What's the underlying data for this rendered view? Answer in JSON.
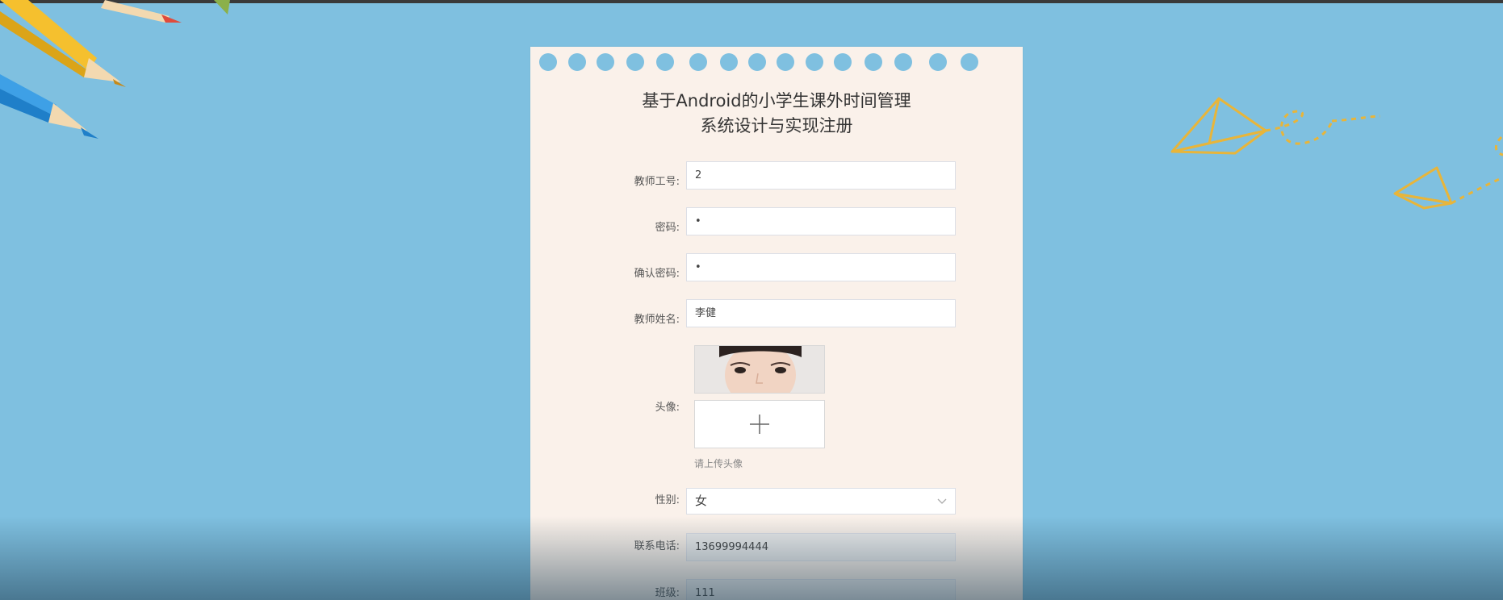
{
  "form": {
    "title_line1": "基于Android的小学生课外时间管理",
    "title_line2": "系统设计与实现注册",
    "teacher_id_label": "教师工号:",
    "teacher_id_value": "2",
    "password_label": "密码:",
    "password_value": "•",
    "confirm_password_label": "确认密码:",
    "confirm_password_value": "•",
    "teacher_name_label": "教师姓名:",
    "teacher_name_value": "李健",
    "avatar_label": "头像:",
    "upload_hint": "请上传头像",
    "gender_label": "性别:",
    "gender_value": "女",
    "phone_label": "联系电话:",
    "phone_value": "13699994444",
    "class_label": "班级:",
    "class_value": "111"
  },
  "colors": {
    "background": "#7fc0e0",
    "card": "#faf1ea",
    "airplane": "#e8b53a"
  },
  "icons": {
    "upload": "plus-icon",
    "select": "chevron-down-icon"
  }
}
